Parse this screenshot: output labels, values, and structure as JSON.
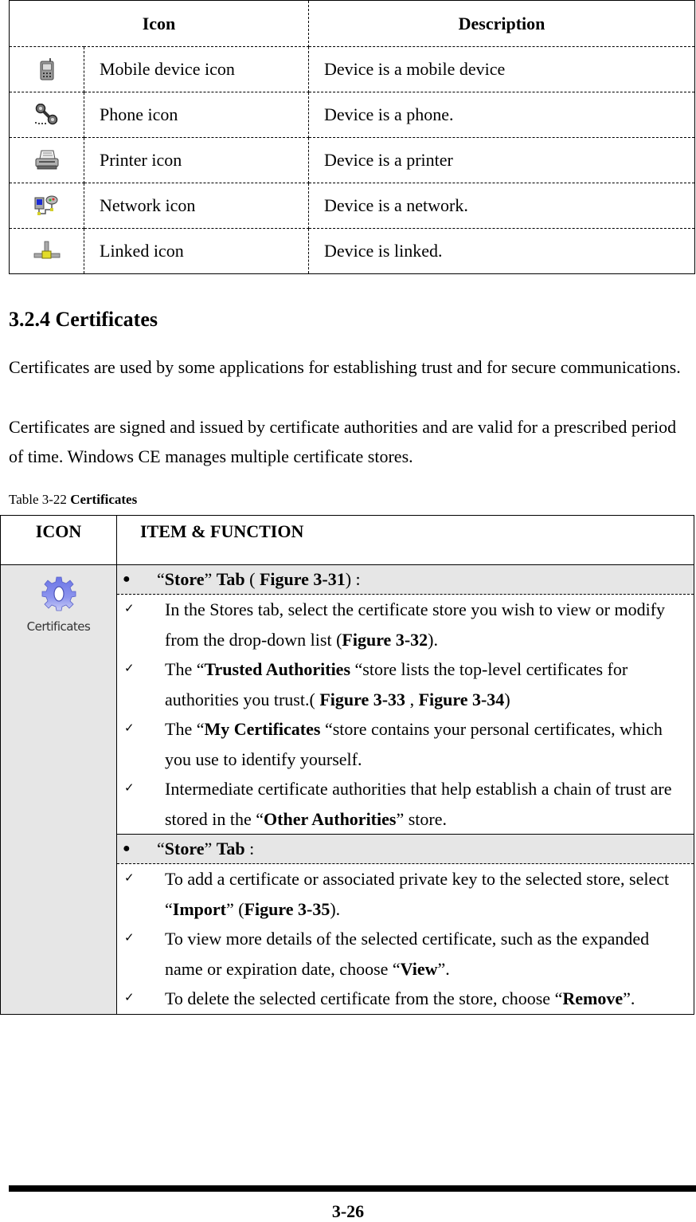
{
  "device_table": {
    "headers": {
      "icon": "Icon",
      "description": "Description"
    },
    "rows": [
      {
        "icon": "mobile-device-icon",
        "name": "Mobile device icon",
        "description": "Device is a mobile device"
      },
      {
        "icon": "phone-icon",
        "name": "Phone icon",
        "description": "Device is a phone."
      },
      {
        "icon": "printer-icon",
        "name": "Printer icon",
        "description": "Device is a printer"
      },
      {
        "icon": "network-icon",
        "name": "Network icon",
        "description": "Device is a network."
      },
      {
        "icon": "linked-icon",
        "name": "Linked icon",
        "description": "Device is linked."
      }
    ]
  },
  "section": {
    "title": "3.2.4 Certificates",
    "paragraph_1": "Certificates are used by some applications for establishing trust and for secure communications.",
    "paragraph_2": "Certificates are signed and issued by certificate authorities and are valid for a prescribed period of time. Windows CE manages multiple certificate stores."
  },
  "caption": {
    "prefix": "Table 3-22 ",
    "title": "Certificates"
  },
  "cert_table": {
    "headers": {
      "icon": "ICON",
      "item": "ITEM & FUNCTION"
    },
    "icon": {
      "name": "certificates-gear-icon",
      "label": "Certificates",
      "color": "#7b84e8"
    },
    "groups": [
      {
        "heading": {
          "q1": "“",
          "bold1": "Store",
          "q2": "” ",
          "bold2": "Tab",
          "mid": " ( ",
          "bold3": "Figure 3-31",
          "end": ") :"
        },
        "items": [
          {
            "parts": [
              {
                "t": "In the Stores tab, select the certificate store you wish to view or modify from the drop-down list ("
              },
              {
                "b": "Figure 3-32"
              },
              {
                "t": ")."
              }
            ]
          },
          {
            "parts": [
              {
                "t": "The “"
              },
              {
                "b": "Trusted Authorities"
              },
              {
                "t": " “store lists the top-level certificates for authorities you trust.( "
              },
              {
                "b": "Figure 3-33"
              },
              {
                "t": " , "
              },
              {
                "b": "Figure 3-34"
              },
              {
                "t": ")"
              }
            ]
          },
          {
            "parts": [
              {
                "t": "The “"
              },
              {
                "b": "My Certificates"
              },
              {
                "t": " “store contains your personal certificates, which you use to identify yourself."
              }
            ]
          },
          {
            "parts": [
              {
                "t": "Intermediate certificate authorities that help establish a chain of trust are stored in the “"
              },
              {
                "b": "Other Authorities"
              },
              {
                "t": "” store."
              }
            ]
          }
        ]
      },
      {
        "heading": {
          "q1": "“",
          "bold1": "Store",
          "q2": "” ",
          "bold2": "Tab",
          "mid": "",
          "bold3": "",
          "end": " :"
        },
        "items": [
          {
            "parts": [
              {
                "t": "To add a certificate or associated private key to the selected store, select “"
              },
              {
                "b": "Import"
              },
              {
                "t": "” ("
              },
              {
                "b": "Figure 3-35"
              },
              {
                "t": ")."
              }
            ]
          },
          {
            "parts": [
              {
                "t": "To view more details of the selected certificate, such as the expanded name or expiration date, choose “"
              },
              {
                "b": "View"
              },
              {
                "t": "”."
              }
            ]
          },
          {
            "parts": [
              {
                "t": "To delete the selected certificate from the store, choose “"
              },
              {
                "b": "Remove"
              },
              {
                "t": "”."
              }
            ]
          }
        ]
      }
    ],
    "bullet_glyph": "●",
    "check_glyph": "✓",
    "heading_bg": "#e6e6e6"
  },
  "footer": {
    "page_number": "3-26"
  }
}
